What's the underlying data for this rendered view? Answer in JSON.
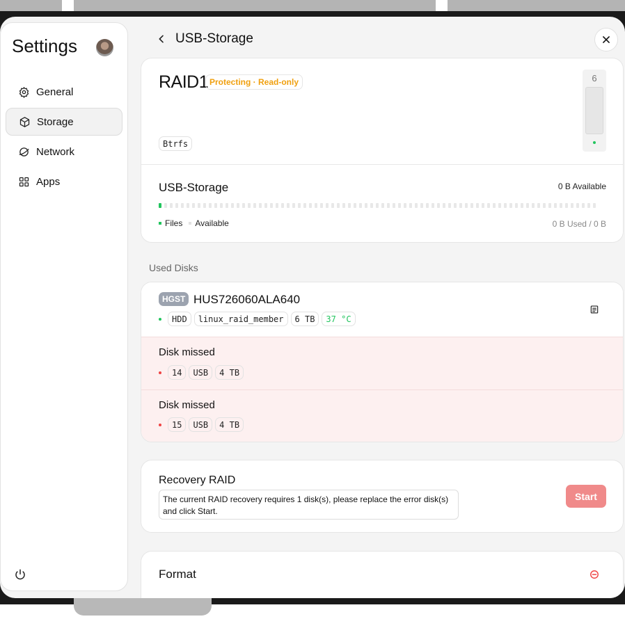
{
  "sidebar": {
    "title": "Settings",
    "items": [
      {
        "label": "General",
        "icon": "gear-icon"
      },
      {
        "label": "Storage",
        "icon": "cube-icon",
        "active": true
      },
      {
        "label": "Network",
        "icon": "globe-icon"
      },
      {
        "label": "Apps",
        "icon": "apps-grid-icon"
      }
    ]
  },
  "header": {
    "title": "USB-Storage"
  },
  "raid": {
    "name": "RAID1",
    "status": "Protecting · Read-only",
    "filesystem": "Btrfs",
    "slot_number": "6"
  },
  "usage": {
    "title": "USB-Storage",
    "available": "0 B Available",
    "legend_files": "Files",
    "legend_available": "Available",
    "used_total": "0 B Used / 0 B",
    "used_fraction": 0.0
  },
  "used_disks": {
    "section_label": "Used Disks",
    "disk": {
      "brand": "HGST",
      "model": "HUS726060ALA640",
      "tags": [
        "HDD",
        "linux_raid_member",
        "6 TB"
      ],
      "temperature": "37 °C"
    },
    "missed": [
      {
        "title": "Disk missed",
        "tags": [
          "14",
          "USB",
          "4 TB"
        ]
      },
      {
        "title": "Disk missed",
        "tags": [
          "15",
          "USB",
          "4 TB"
        ]
      }
    ]
  },
  "recovery": {
    "title": "Recovery RAID",
    "message": "The current RAID recovery requires 1 disk(s), please replace the error disk(s) and click Start.",
    "start_label": "Start"
  },
  "format": {
    "title": "Format"
  },
  "colors": {
    "warning": "#f0a010",
    "success": "#22c55e",
    "danger": "#ef4444",
    "missed_bg": "#fdf0f0"
  }
}
